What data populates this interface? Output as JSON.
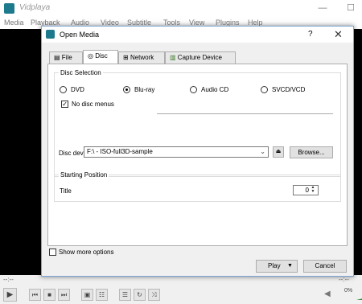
{
  "app": {
    "title": "Vidplaya",
    "minimize": "—",
    "maximize": "☐",
    "close": "✕"
  },
  "menu": [
    "Media",
    "Playback",
    "Audio",
    "Video",
    "Subtitle",
    "Tools",
    "View",
    "Plugins",
    "Help"
  ],
  "player": {
    "time_elapsed": "--:--",
    "time_remaining": "--:--",
    "volume": "0%"
  },
  "dialog": {
    "title": "Open Media",
    "help": "?",
    "close": "✕",
    "tabs": [
      {
        "label": "File",
        "icon": "file-icon"
      },
      {
        "label": "Disc",
        "icon": "disc-icon"
      },
      {
        "label": "Network",
        "icon": "network-icon"
      },
      {
        "label": "Capture Device",
        "icon": "capture-device-icon"
      }
    ],
    "active_tab": "Disc",
    "disc_selection": {
      "label": "Disc Selection",
      "options": [
        "DVD",
        "Blu-ray",
        "Audio CD",
        "SVCD/VCD"
      ],
      "selected": "Blu-ray",
      "no_disc_menus_label": "No disc menus",
      "no_disc_menus_checked": true
    },
    "disc_device": {
      "label": "Disc device",
      "value": "F:\\ - ISO-full3D-sample",
      "browse_label": "Browse..."
    },
    "starting_position": {
      "label": "Starting Position",
      "title_label": "Title",
      "title_value": "0"
    },
    "show_more_options": "Show more options",
    "play_label": "Play",
    "cancel_label": "Cancel"
  }
}
